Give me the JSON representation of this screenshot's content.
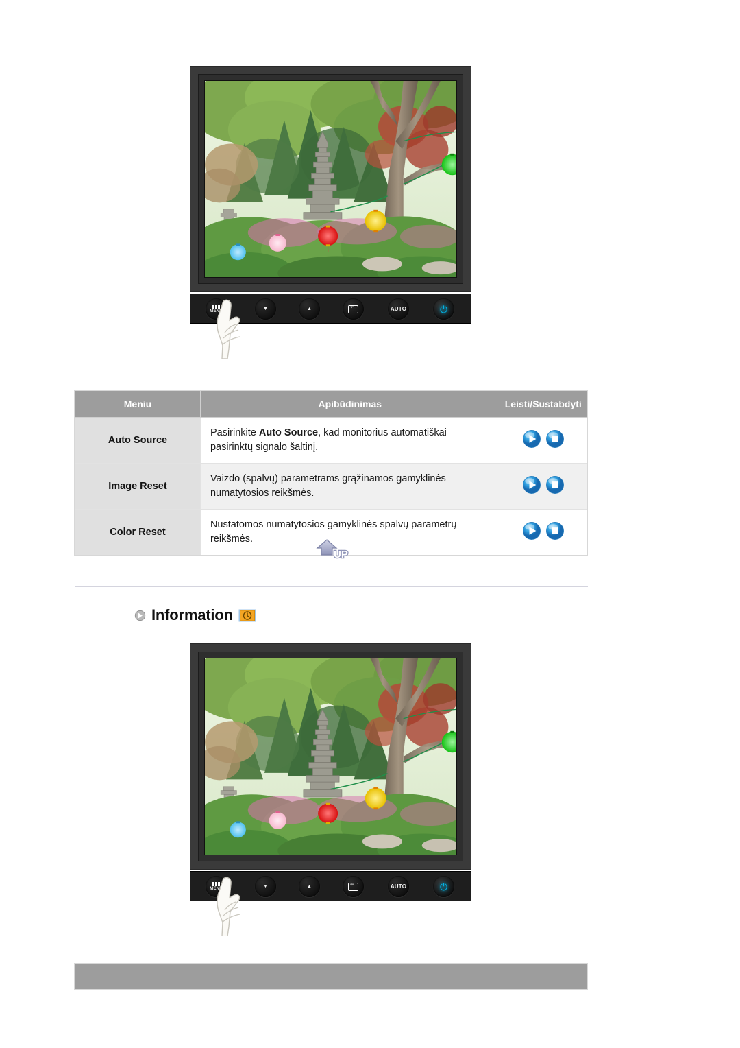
{
  "page": {
    "background_color": "#ffffff"
  },
  "monitor_illustrations": [
    {
      "id": "monitor-top",
      "alt": "LCD monitor displaying a photo of a Korean garden with a stone pagoda and colorful paper lanterns",
      "caption": ""
    },
    {
      "id": "monitor-bottom",
      "alt": "LCD monitor displaying a photo of a Korean garden with a stone pagoda and colorful paper lanterns",
      "caption": ""
    }
  ],
  "control_bar": {
    "buttons": [
      {
        "name": "menu-button",
        "label": "MENU",
        "icon": "menu-bars-icon"
      },
      {
        "name": "down-button",
        "label": "",
        "icon": "down-arrow-icon",
        "glyph": "▼"
      },
      {
        "name": "up-brightness-button",
        "label": "",
        "icon": "up-arrow-brightness-icon",
        "glyph": "▲"
      },
      {
        "name": "enter-source-button",
        "label": "",
        "icon": "enter-icon"
      },
      {
        "name": "auto-button",
        "label": "AUTO",
        "icon": "auto-icon"
      },
      {
        "name": "power-button",
        "label": "",
        "icon": "power-icon",
        "glyph": "⏻"
      }
    ],
    "hand_pointer": "hand-pointing-at-menu-button"
  },
  "table": {
    "headers": [
      "Meniu",
      "Apibūdinimas",
      "Leisti/Sustabdyti"
    ],
    "rows": [
      {
        "menu": "Auto Source",
        "description_prefix": "Pasirinkite ",
        "description_bold": "Auto Source",
        "description_suffix": ", kad monitorius automatiškai pasirinktų signalo šaltinį.",
        "play_label": "play-button",
        "stop_label": "stop-button"
      },
      {
        "menu": "Image Reset",
        "description_prefix": "Vaizdo (spalvų) parametrams grąžinamos gamyklinės numatytosios reikšmės.",
        "description_bold": "",
        "description_suffix": "",
        "play_label": "play-button",
        "stop_label": "stop-button"
      },
      {
        "menu": "Color Reset",
        "description_prefix": "Nustatomos numatytosios gamyklinės spalvų parametrų reikšmės.",
        "description_bold": "",
        "description_suffix": "",
        "play_label": "play-button",
        "stop_label": "stop-button"
      }
    ]
  },
  "up_button": {
    "label": "UP",
    "icon": "up-arrow-icon"
  },
  "information_section": {
    "bullet_icon": "circle-arrow-right-icon",
    "title": "Information",
    "badge_icon": "information-clock-icon",
    "badge_color": "#f5a623"
  }
}
